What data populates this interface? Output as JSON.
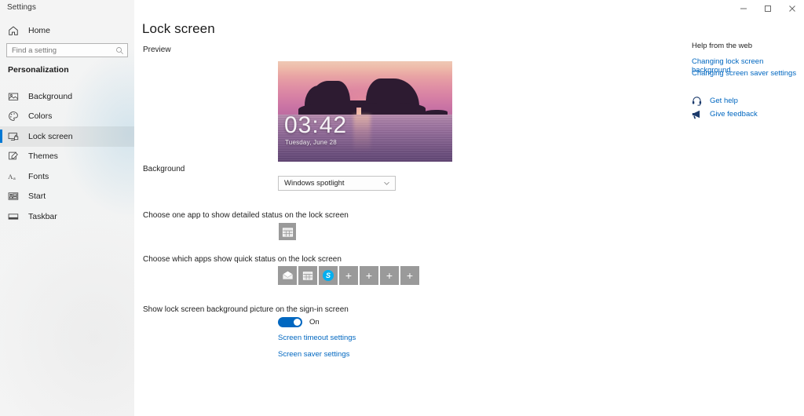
{
  "window": {
    "title": "Settings",
    "controls": [
      {
        "name": "minimize",
        "glyph": "─"
      },
      {
        "name": "maximize",
        "glyph": "☐"
      },
      {
        "name": "close",
        "glyph": "✕"
      }
    ]
  },
  "sidebar": {
    "home_label": "Home",
    "search": {
      "placeholder": "Find a setting",
      "value": ""
    },
    "category": "Personalization",
    "items": [
      {
        "label": "Background",
        "icon": "picture-icon",
        "selected": false
      },
      {
        "label": "Colors",
        "icon": "palette-icon",
        "selected": false
      },
      {
        "label": "Lock screen",
        "icon": "lock-screen-icon",
        "selected": true
      },
      {
        "label": "Themes",
        "icon": "themes-icon",
        "selected": false
      },
      {
        "label": "Fonts",
        "icon": "fonts-icon",
        "selected": false
      },
      {
        "label": "Start",
        "icon": "start-icon",
        "selected": false
      },
      {
        "label": "Taskbar",
        "icon": "taskbar-icon",
        "selected": false
      }
    ]
  },
  "main": {
    "page_title": "Lock screen",
    "preview_label": "Preview",
    "preview": {
      "time": "03:42",
      "date": "Tuesday, June 28",
      "scene": "sunset-over-sea-with-rock-arch"
    },
    "background": {
      "label": "Background",
      "selected": "Windows spotlight"
    },
    "detailed_status": {
      "label": "Choose one app to show detailed status on the lock screen",
      "apps": [
        {
          "name": "calendar",
          "glyph": "calendar-icon"
        }
      ]
    },
    "quick_status": {
      "label": "Choose which apps show quick status on the lock screen",
      "apps": [
        {
          "name": "mail",
          "glyph": "mail-icon"
        },
        {
          "name": "calendar",
          "glyph": "calendar-icon"
        },
        {
          "name": "skype",
          "glyph": "skype-icon",
          "badge": "S"
        },
        {
          "name": "add",
          "glyph": "plus-icon"
        },
        {
          "name": "add",
          "glyph": "plus-icon"
        },
        {
          "name": "add",
          "glyph": "plus-icon"
        },
        {
          "name": "add",
          "glyph": "plus-icon"
        }
      ]
    },
    "signin": {
      "label": "Show lock screen background picture on the sign-in screen",
      "state": "On"
    },
    "links": [
      {
        "label": "Screen timeout settings"
      },
      {
        "label": "Screen saver settings"
      }
    ]
  },
  "help": {
    "title": "Help from the web",
    "links": [
      {
        "label": "Changing lock screen background"
      },
      {
        "label": "Changing screen saver settings"
      }
    ],
    "actions": [
      {
        "label": "Get help",
        "icon": "support-headset-icon"
      },
      {
        "label": "Give feedback",
        "icon": "megaphone-icon"
      }
    ]
  },
  "colors": {
    "accent": "#0078d4",
    "link": "#0067c0",
    "toggle_on": "#0067c0",
    "skype": "#00aff0",
    "tile": "#9a9a9a"
  }
}
